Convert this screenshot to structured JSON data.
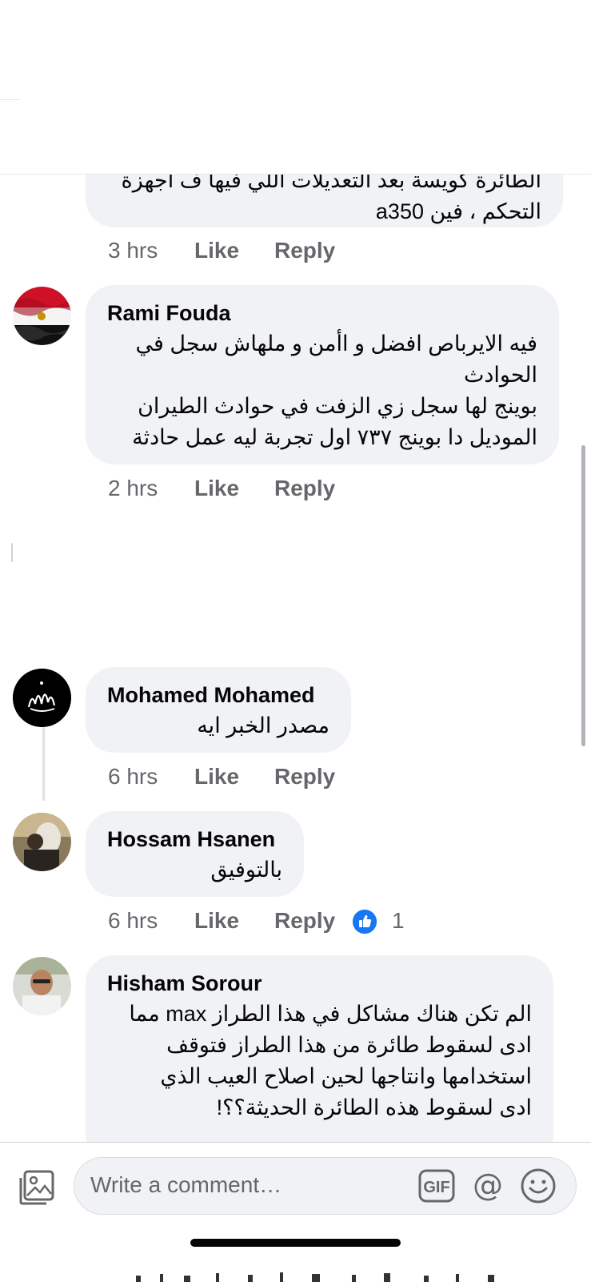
{
  "comments": [
    {
      "author": "",
      "text_lines": [
        "الطائرة كويسة بعد التعديلات اللي فيها ف اجهزة",
        "التحكم ، فين a350"
      ],
      "time": "3 hrs"
    },
    {
      "author": "Rami Fouda",
      "text_lines": [
        "فيه الايرباص افضل و اأمن و ملهاش سجل في",
        "الحوادث",
        "بوينج لها سجل زي الزفت في حوادث الطيران",
        "الموديل دا بوينج ٧٣٧ اول تجربة ليه عمل حادثة"
      ],
      "time": "2 hrs"
    },
    {
      "author": "Mohamed Mohamed",
      "text_lines": [
        "مصدر الخبر ايه"
      ],
      "time": "6 hrs"
    },
    {
      "author": "Hossam Hsanen",
      "text_lines": [
        "بالتوفيق"
      ],
      "time": "6 hrs",
      "reaction_count": "1"
    },
    {
      "author": "Hisham Sorour",
      "text_lines": [
        "الم تكن هناك مشاكل في هذا الطراز max  مما",
        "ادى لسقوط طائرة من هذا الطراز فتوقف",
        "استخدامها وانتاجها لحين اصلاح العيب الذي",
        "ادى لسقوط هذه الطائرة الحديثة؟؟!"
      ],
      "time": ""
    }
  ],
  "actions": {
    "like": "Like",
    "reply": "Reply"
  },
  "composer": {
    "placeholder": "Write a comment…",
    "gif_label": "GIF",
    "at_symbol": "@"
  },
  "icons": {
    "photo": "photo-icon",
    "gif": "gif-icon",
    "mention": "at-icon",
    "emoji": "emoji-icon",
    "like_reaction": "thumbs-up-icon"
  },
  "colors": {
    "bubble": "#f0f2f5",
    "meta": "#65676b",
    "like_blue": "#1877f2",
    "text": "#050505"
  }
}
